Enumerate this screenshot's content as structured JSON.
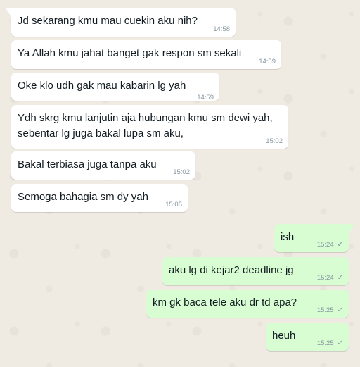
{
  "messages": [
    {
      "dir": "in",
      "text": "Jd sekarang kmu mau cuekin aku nih?",
      "time": "14:58"
    },
    {
      "dir": "in",
      "text": "Ya Allah kmu jahat banget gak respon sm sekali",
      "time": "14:59"
    },
    {
      "dir": "in",
      "text": "Oke klo udh gak mau kabarin lg yah",
      "time": "14:59"
    },
    {
      "dir": "in",
      "text": "Ydh skrg kmu lanjutin aja hubungan kmu sm dewi yah,\nsebentar lg juga bakal lupa sm aku,",
      "time": "15:02"
    },
    {
      "dir": "in",
      "text": "Bakal terbiasa juga tanpa aku",
      "time": "15:02"
    },
    {
      "dir": "in",
      "text": "Semoga bahagia sm dy yah",
      "time": "15:05"
    },
    {
      "dir": "out",
      "text": "ish",
      "time": "15:24",
      "status_icon": "single-check-icon",
      "status_glyph": "✓"
    },
    {
      "dir": "out",
      "text": "aku lg di kejar2 deadline jg",
      "time": "15:24",
      "status_icon": "single-check-icon",
      "status_glyph": "✓"
    },
    {
      "dir": "out",
      "text": "km gk baca tele aku dr td apa?",
      "time": "15:25",
      "status_icon": "single-check-icon",
      "status_glyph": "✓"
    },
    {
      "dir": "out",
      "text": "heuh",
      "time": "15:25",
      "status_icon": "single-check-icon",
      "status_glyph": "✓"
    }
  ],
  "colors": {
    "background": "#efeae2",
    "incoming_bubble": "#ffffff",
    "outgoing_bubble": "#d9fdd3",
    "meta_text": "#8696a0"
  }
}
